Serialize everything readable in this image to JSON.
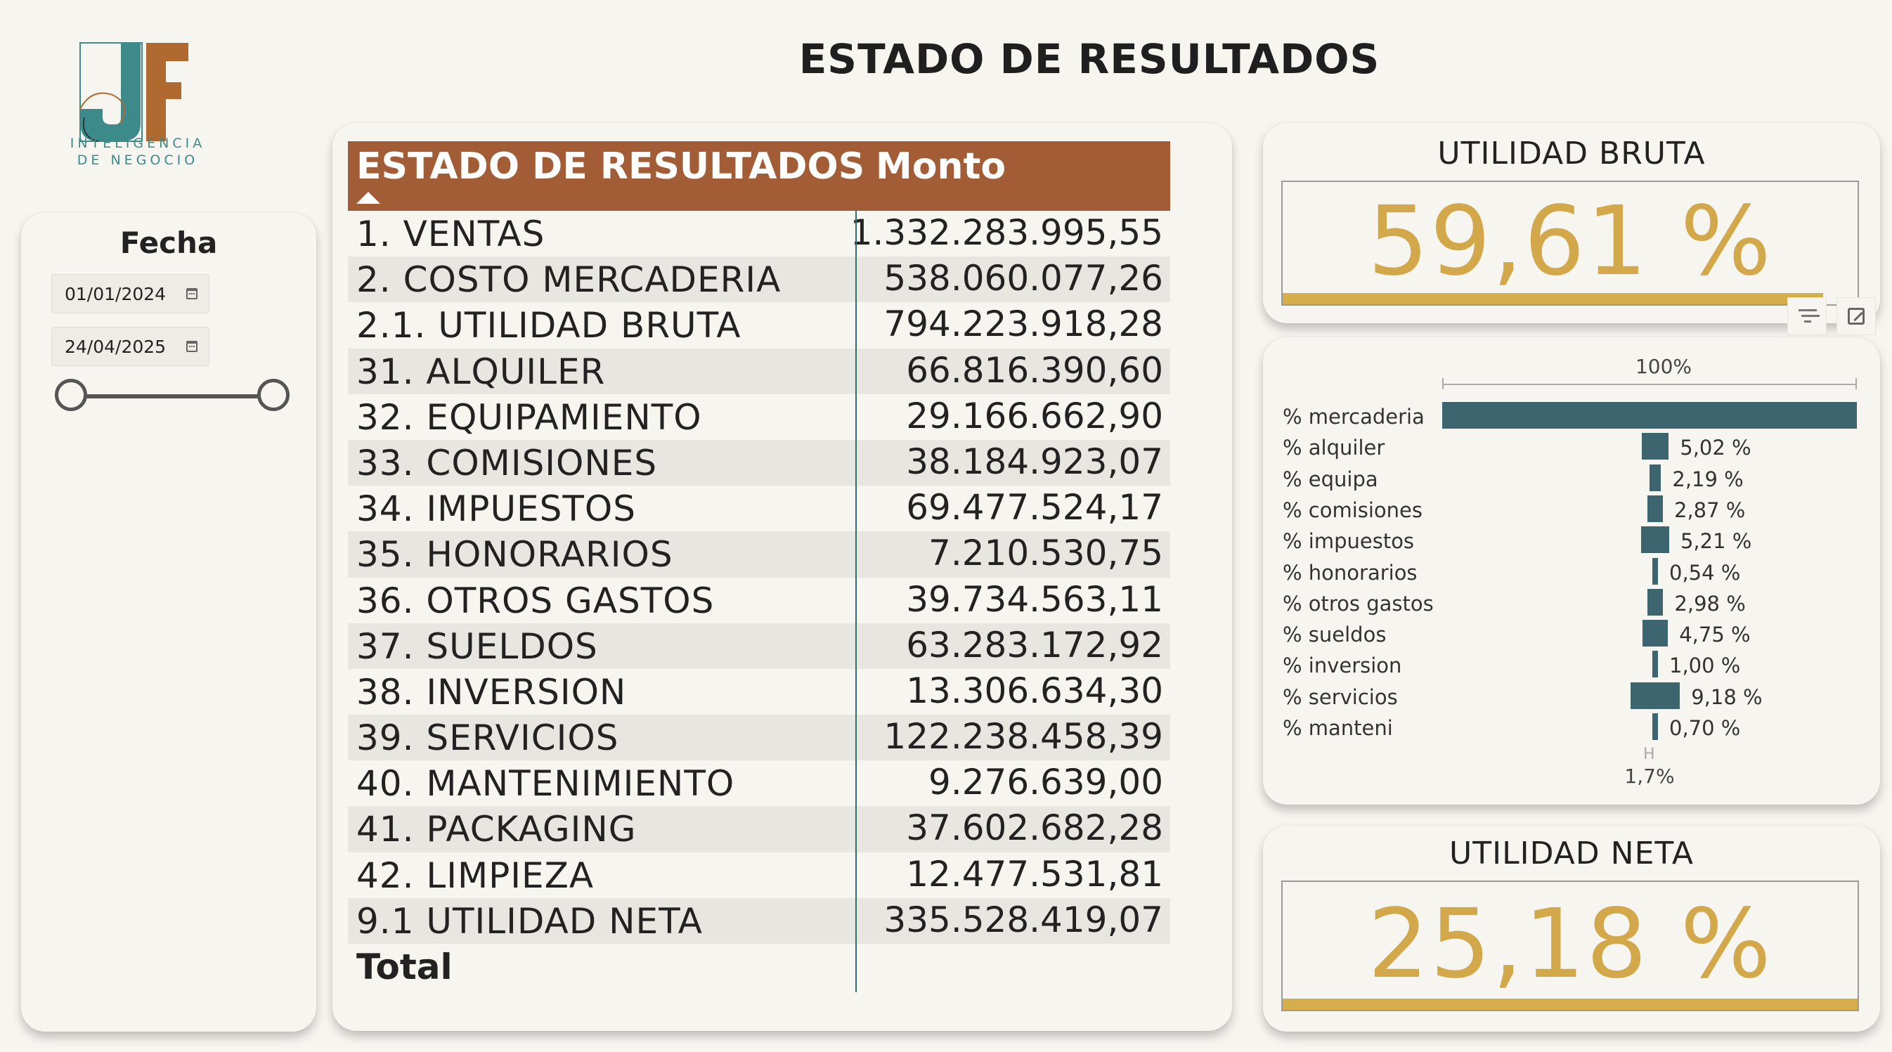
{
  "header": {
    "title": "ESTADO DE RESULTADOS",
    "logo_subtitle_line1": "INTELIGENCIA",
    "logo_subtitle_line2": "DE NEGOCIO"
  },
  "colors": {
    "header_brown": "#a35d36",
    "teal": "#3c6570",
    "gold": "#d3a84a"
  },
  "date_slicer": {
    "title": "Fecha",
    "start": "01/01/2024",
    "end": "24/04/2025",
    "icon": "calendar-icon"
  },
  "table": {
    "col1_header": "ESTADO DE RESULTADOS",
    "col2_header": "Monto",
    "sort": "ascending",
    "rows": [
      {
        "label": "1. VENTAS",
        "value": "1.332.283.995,55"
      },
      {
        "label": "2. COSTO MERCADERIA",
        "value": "538.060.077,26"
      },
      {
        "label": "2.1. UTILIDAD BRUTA",
        "value": "794.223.918,28"
      },
      {
        "label": "31. ALQUILER",
        "value": "66.816.390,60"
      },
      {
        "label": "32. EQUIPAMIENTO",
        "value": "29.166.662,90"
      },
      {
        "label": "33. COMISIONES",
        "value": "38.184.923,07"
      },
      {
        "label": "34. IMPUESTOS",
        "value": "69.477.524,17"
      },
      {
        "label": "35. HONORARIOS",
        "value": "7.210.530,75"
      },
      {
        "label": "36. OTROS GASTOS",
        "value": "39.734.563,11"
      },
      {
        "label": "37. SUELDOS",
        "value": "63.283.172,92"
      },
      {
        "label": "38. INVERSION",
        "value": "13.306.634,30"
      },
      {
        "label": "39. SERVICIOS",
        "value": "122.238.458,39"
      },
      {
        "label": "40. MANTENIMIENTO",
        "value": "9.276.639,00"
      },
      {
        "label": "41. PACKAGING",
        "value": "37.602.682,28"
      },
      {
        "label": "42. LIMPIEZA",
        "value": "12.477.531,81"
      },
      {
        "label": "9.1 UTILIDAD NETA",
        "value": "335.528.419,07"
      }
    ],
    "total_label": "Total"
  },
  "utilidad_bruta": {
    "title": "UTILIDAD BRUTA",
    "value": "59,61 %",
    "fill_percent": 94
  },
  "utilidad_neta": {
    "title": "UTILIDAD NETA",
    "value": "25,18 %",
    "fill_percent": 100
  },
  "percent_bars": {
    "top_label": "100%",
    "bottom_label": "1,7%",
    "items": [
      {
        "label": "% mercaderia",
        "pct": 100,
        "text": ""
      },
      {
        "label": "% alquiler",
        "pct": 5.02,
        "text": "5,02 %"
      },
      {
        "label": "% equipa",
        "pct": 2.19,
        "text": "2,19 %"
      },
      {
        "label": "% comisiones",
        "pct": 2.87,
        "text": "2,87 %"
      },
      {
        "label": "% impuestos",
        "pct": 5.21,
        "text": "5,21 %"
      },
      {
        "label": "% honorarios",
        "pct": 0.54,
        "text": "0,54 %"
      },
      {
        "label": "% otros gastos",
        "pct": 2.98,
        "text": "2,98 %"
      },
      {
        "label": "% sueldos",
        "pct": 4.75,
        "text": "4,75 %"
      },
      {
        "label": "% inversion",
        "pct": 1.0,
        "text": "1,00 %"
      },
      {
        "label": "% servicios",
        "pct": 9.18,
        "text": "9,18 %"
      },
      {
        "label": "% manteni",
        "pct": 0.7,
        "text": "0,70 %"
      }
    ]
  }
}
